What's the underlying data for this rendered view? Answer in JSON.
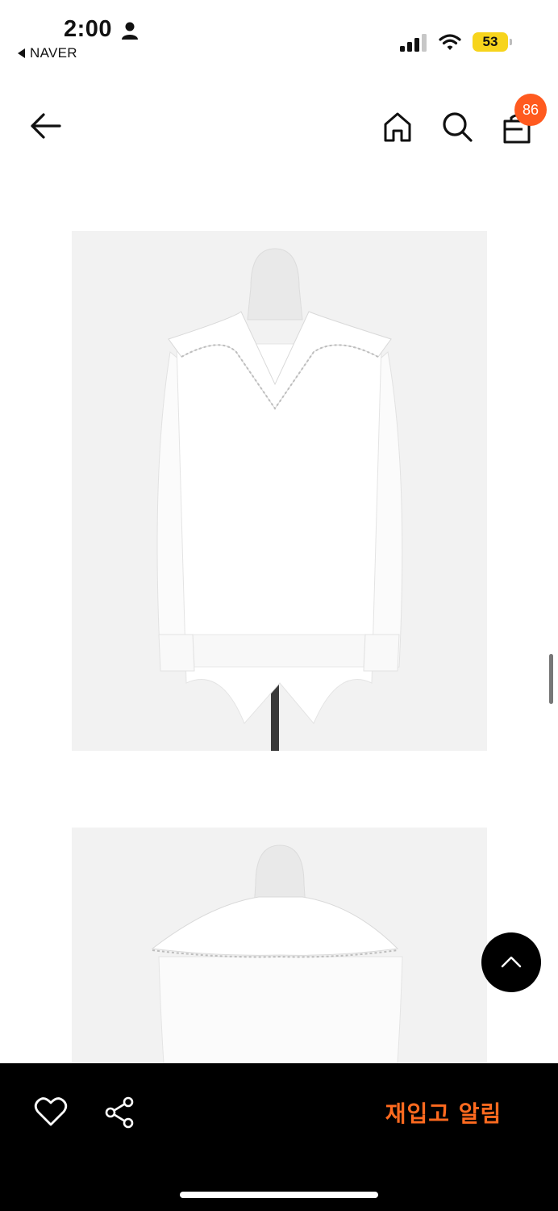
{
  "status_bar": {
    "time": "2:00",
    "back_app_label": "NAVER",
    "battery_level": "53",
    "battery_color": "#f7d41c"
  },
  "nav": {
    "cart_count": "86",
    "badge_color": "#ff5a1f",
    "icons": [
      "arrow-left-icon",
      "home-icon",
      "search-icon",
      "bag-icon"
    ]
  },
  "product_images": [
    {
      "subject": "white blouse with lace-trimmed sailor collar on mannequin, front view"
    },
    {
      "subject": "white blouse with lace-trimmed sailor collar on mannequin, back view"
    }
  ],
  "bottom_bar": {
    "restock_label": "재입고 알림",
    "accent_color": "#ff6a1f",
    "icons": [
      "heart-icon",
      "share-icon"
    ]
  }
}
